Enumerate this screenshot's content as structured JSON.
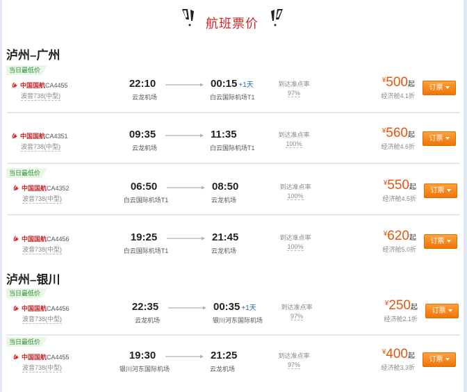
{
  "header": {
    "title": "航班票价"
  },
  "routes": [
    {
      "title": "泸州–广州",
      "flights": [
        {
          "badge": "当日最低价",
          "airline": "中国国航",
          "flight_no": "CA4455",
          "plane": "波音738(中型)",
          "dep_time": "22:10",
          "dep_airport": "云龙机场",
          "arr_time": "00:15",
          "plus_day": "+1天",
          "arr_airport": "白云国际机场T1",
          "ontime_label": "到达准点率",
          "ontime": "97%",
          "currency": "¥",
          "price": "500",
          "qi": "起",
          "discount": "经济舱4.1折",
          "book": "订票"
        },
        {
          "badge": "",
          "airline": "中国国航",
          "flight_no": "CA4351",
          "plane": "波音738(中型)",
          "dep_time": "09:35",
          "dep_airport": "云龙机场",
          "arr_time": "11:35",
          "plus_day": "",
          "arr_airport": "白云国际机场T1",
          "ontime_label": "到达准点率",
          "ontime": "100%",
          "currency": "¥",
          "price": "560",
          "qi": "起",
          "discount": "经济舱4.6折",
          "book": "订票"
        },
        {
          "badge": "当日最低价",
          "airline": "中国国航",
          "flight_no": "CA4352",
          "plane": "波音738(中型)",
          "dep_time": "06:50",
          "dep_airport": "白云国际机场T1",
          "arr_time": "08:50",
          "plus_day": "",
          "arr_airport": "云龙机场",
          "ontime_label": "到达准点率",
          "ontime": "100%",
          "currency": "¥",
          "price": "550",
          "qi": "起",
          "discount": "经济舱4.5折",
          "book": "订票"
        },
        {
          "badge": "",
          "airline": "中国国航",
          "flight_no": "CA4456",
          "plane": "波音738(中型)",
          "dep_time": "19:25",
          "dep_airport": "白云国际机场T1",
          "arr_time": "21:45",
          "plus_day": "",
          "arr_airport": "云龙机场",
          "ontime_label": "到达准点率",
          "ontime": "100%",
          "currency": "¥",
          "price": "620",
          "qi": "起",
          "discount": "经济舱5.0折",
          "book": "订票"
        }
      ]
    },
    {
      "title": "泸州–银川",
      "flights": [
        {
          "badge": "当日最低价",
          "airline": "中国国航",
          "flight_no": "CA4456",
          "plane": "波音738(中型)",
          "dep_time": "22:35",
          "dep_airport": "云龙机场",
          "arr_time": "00:35",
          "plus_day": "+1天",
          "arr_airport": "银川河东国际机场",
          "ontime_label": "到达准点率",
          "ontime": "97%",
          "currency": "¥",
          "price": "250",
          "qi": "起",
          "discount": "经济舱2.1折",
          "book": "订票"
        },
        {
          "badge": "当日最低价",
          "airline": "中国国航",
          "flight_no": "CA4455",
          "plane": "波音738(中型)",
          "dep_time": "19:30",
          "dep_airport": "银川河东国际机场",
          "arr_time": "21:25",
          "plus_day": "",
          "arr_airport": "云龙机场",
          "ontime_label": "到达准点率",
          "ontime": "97%",
          "currency": "¥",
          "price": "400",
          "qi": "起",
          "discount": "经济舱3.3折",
          "book": "订票"
        }
      ]
    }
  ]
}
